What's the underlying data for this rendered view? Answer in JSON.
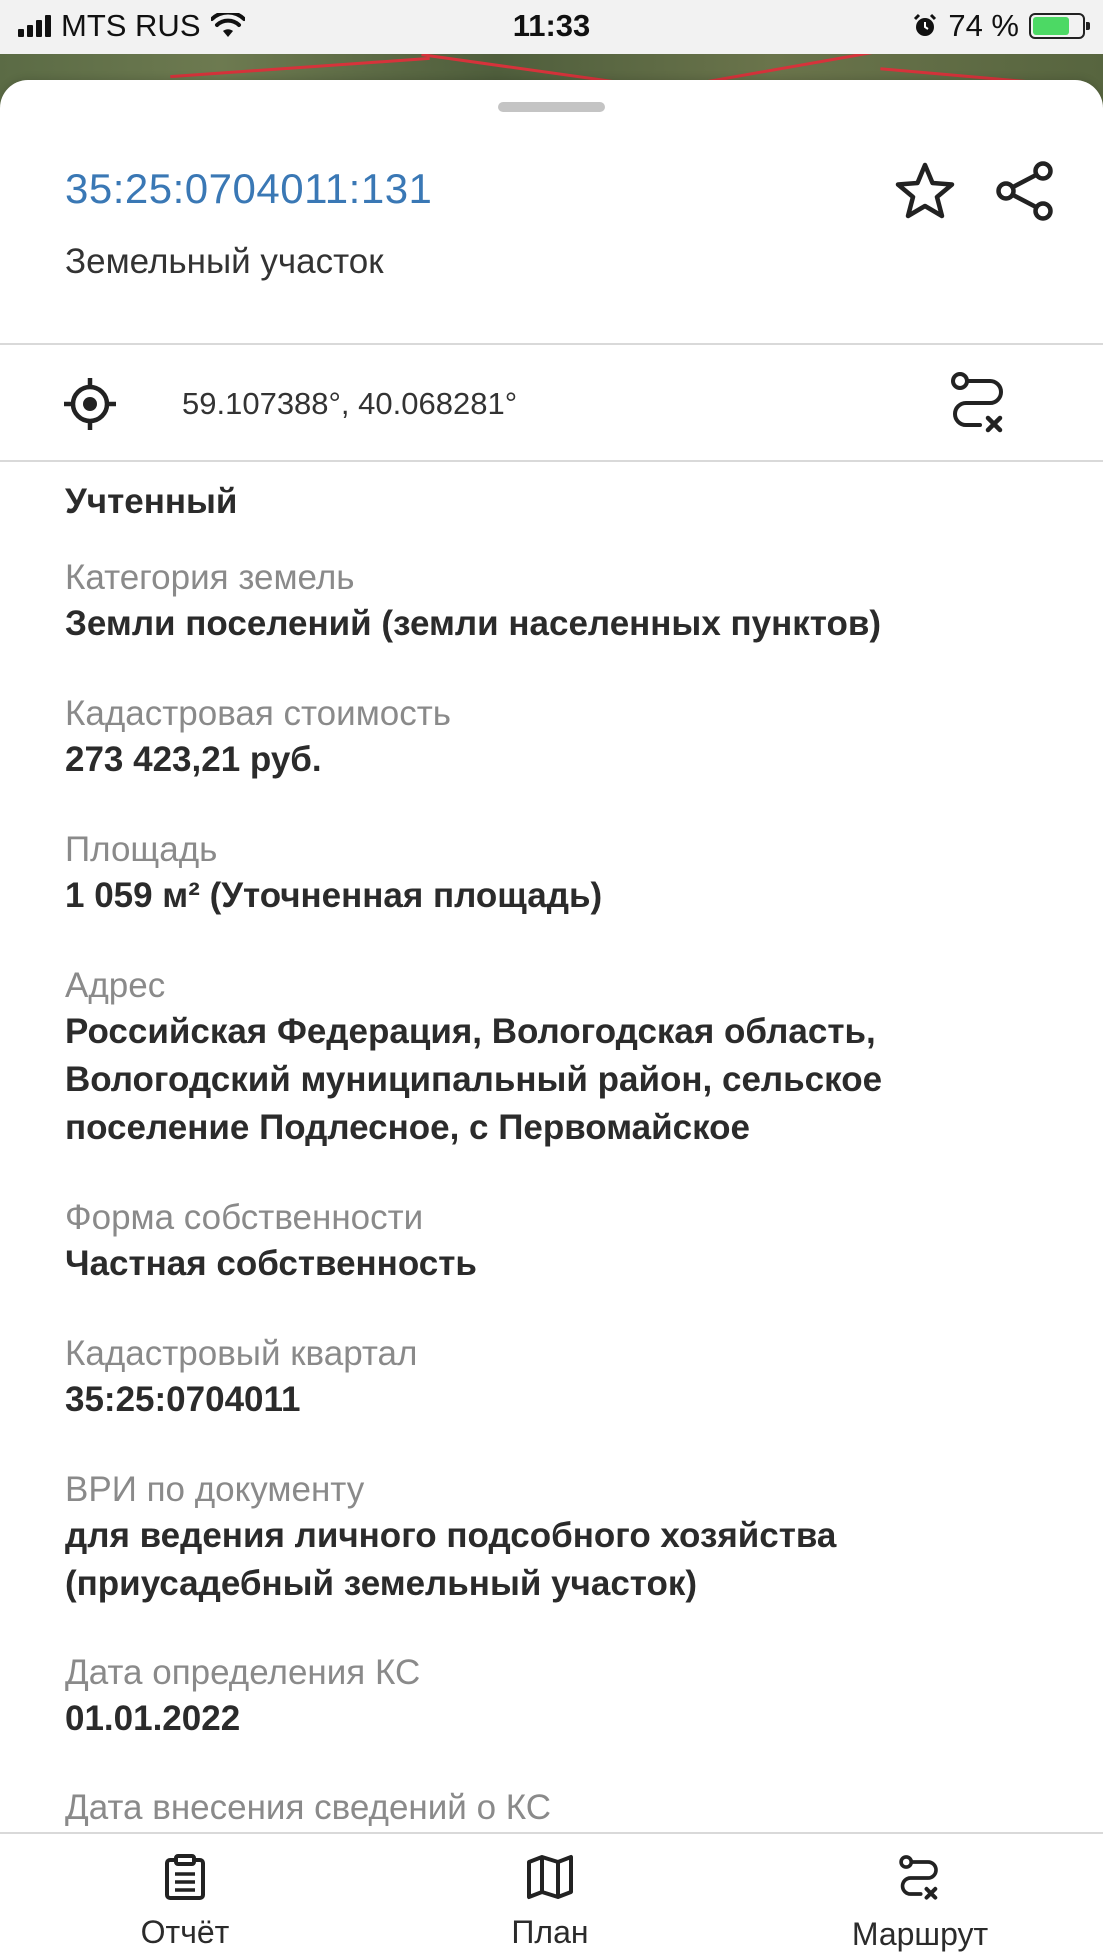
{
  "status_bar": {
    "carrier": "MTS RUS",
    "time": "11:33",
    "battery_percent": "74 %",
    "battery_level": 0.74
  },
  "sheet": {
    "cadastral_number": "35:25:0704011:131",
    "object_type": "Земельный участок",
    "coordinates": "59.107388°, 40.068281°",
    "icons": {
      "favorite": "star-icon",
      "share": "share-icon",
      "locate": "crosshair-icon",
      "route_clear": "route-clear-icon"
    }
  },
  "details": {
    "status_value": "Учтенный",
    "fields": [
      {
        "label": "Категория земель",
        "value": "Земли поселений (земли населенных пунктов)"
      },
      {
        "label": "Кадастровая стоимость",
        "value": "273 423,21 руб."
      },
      {
        "label": "Площадь",
        "value": "1 059 м² (Уточненная площадь)"
      },
      {
        "label": "Адрес",
        "value_lines": [
          "Российская Федерация, Вологодская область,",
          "Вологодский муниципальный район, сельское",
          "поселение Подлесное, с Первомайское"
        ]
      },
      {
        "label": "Форма собственности",
        "value": "Частная собственность"
      },
      {
        "label": "Кадастровый квартал",
        "value": "35:25:0704011"
      },
      {
        "label": "ВРИ по документу",
        "value_lines": [
          "для ведения личного подсобного хозяйства",
          "(приусадебный земельный участок)"
        ]
      },
      {
        "label": "Дата определения КС",
        "value": "01.01.2022"
      },
      {
        "label": "Дата внесения сведений о КС",
        "value": ""
      }
    ]
  },
  "tab_bar": {
    "tabs": [
      {
        "label": "Отчёт",
        "icon": "clipboard-icon"
      },
      {
        "label": "План",
        "icon": "map-icon"
      },
      {
        "label": "Маршрут",
        "icon": "route-icon"
      }
    ]
  }
}
